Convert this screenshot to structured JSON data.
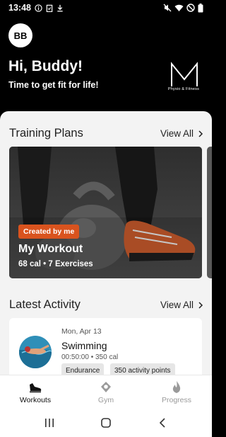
{
  "status_bar": {
    "time": "13:48"
  },
  "header": {
    "avatar_initials": "BB",
    "greeting": "Hi, Buddy!",
    "tagline": "Time to get fit for life!",
    "logo_letter": "M",
    "logo_sub": "Physio & Fitness"
  },
  "training_plans": {
    "title": "Training Plans",
    "view_all": "View All",
    "card": {
      "badge": "Created by me",
      "title": "My Workout",
      "meta": "68 cal • 7 Exercises"
    }
  },
  "latest_activity": {
    "title": "Latest Activity",
    "view_all": "View All",
    "item": {
      "date": "Mon, Apr 13",
      "name": "Swimming",
      "meta": "00:50:00 • 350 cal",
      "tags": [
        "Endurance",
        "350 activity points"
      ]
    }
  },
  "bottom_nav": {
    "items": [
      {
        "label": "Workouts",
        "icon": "shoe-icon",
        "active": true
      },
      {
        "label": "Gym",
        "icon": "location-pin-icon",
        "active": false
      },
      {
        "label": "Progress",
        "icon": "flame-icon",
        "active": false
      }
    ]
  },
  "colors": {
    "accent": "#d9531e",
    "header_bg": "#000000",
    "sheet_bg": "#f3f3f3"
  }
}
